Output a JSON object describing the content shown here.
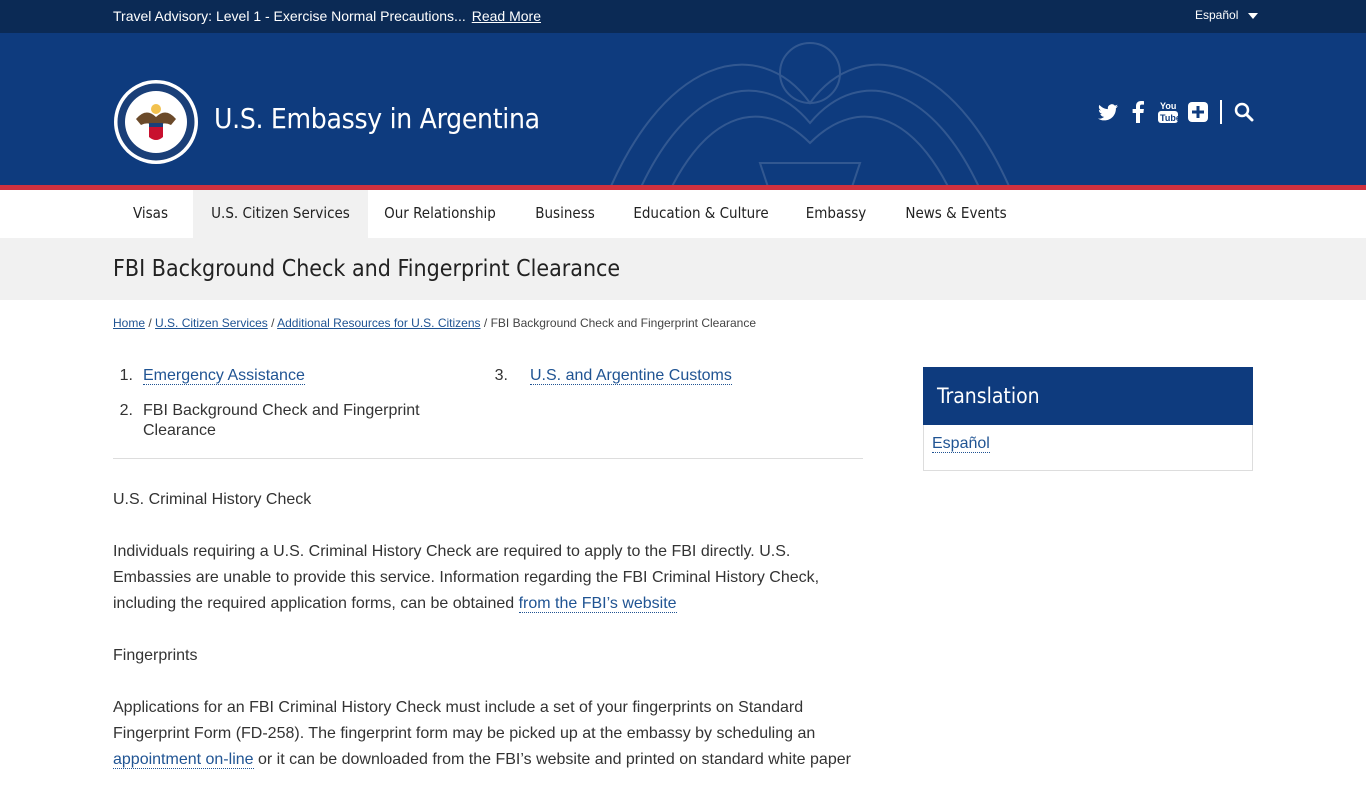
{
  "advisory": {
    "text": "Travel Advisory: Level 1 - Exercise Normal Precautions...",
    "link": "Read More",
    "language": "Español"
  },
  "header": {
    "site_title": "U.S. Embassy in Argentina",
    "seal_alt": "Department of State seal"
  },
  "social": [
    "twitter-icon",
    "facebook-icon",
    "youtube-icon",
    "plus-icon",
    "search-icon"
  ],
  "nav": [
    {
      "label": "Visas"
    },
    {
      "label": "U.S. Citizen Services",
      "active": true
    },
    {
      "label": "Our Relationship"
    },
    {
      "label": "Business"
    },
    {
      "label": "Education & Culture"
    },
    {
      "label": "Embassy"
    },
    {
      "label": "News & Events"
    }
  ],
  "page_title": "FBI Background Check and Fingerprint Clearance",
  "breadcrumb": {
    "home": "Home",
    "sep": "/",
    "level1": "U.S. Citizen Services",
    "level2": "Additional Resources for U.S. Citizens",
    "current": "FBI Background Check and Fingerprint Clearance"
  },
  "toc": [
    {
      "num": "1.",
      "label": "Emergency Assistance"
    },
    {
      "num": "2.",
      "label": "FBI Background Check and Fingerprint Clearance"
    },
    {
      "num": "3.",
      "label": "U.S. and Argentine Customs"
    }
  ],
  "content": {
    "h1": "U.S. Criminal History Check",
    "p1": "Individuals requiring a U.S. Criminal History Check are required to apply to the FBI directly. U.S. Embassies are unable to provide this service. Information regarding the FBI Criminal History Check, including the required application forms, can be obtained ",
    "p1_link": "from the FBI’s website",
    "h2": "Fingerprints",
    "p2": "Applications for an FBI Criminal History Check must include a set of your fingerprints on Standard Fingerprint Form (FD-258). The fingerprint form may be picked up at the embassy by scheduling an ",
    "p2_link": "appointment on-line",
    "p2_tail": " or it can be downloaded from the FBI’s website and printed on standard white paper"
  },
  "translation": {
    "title": "Translation",
    "link": "Español"
  }
}
